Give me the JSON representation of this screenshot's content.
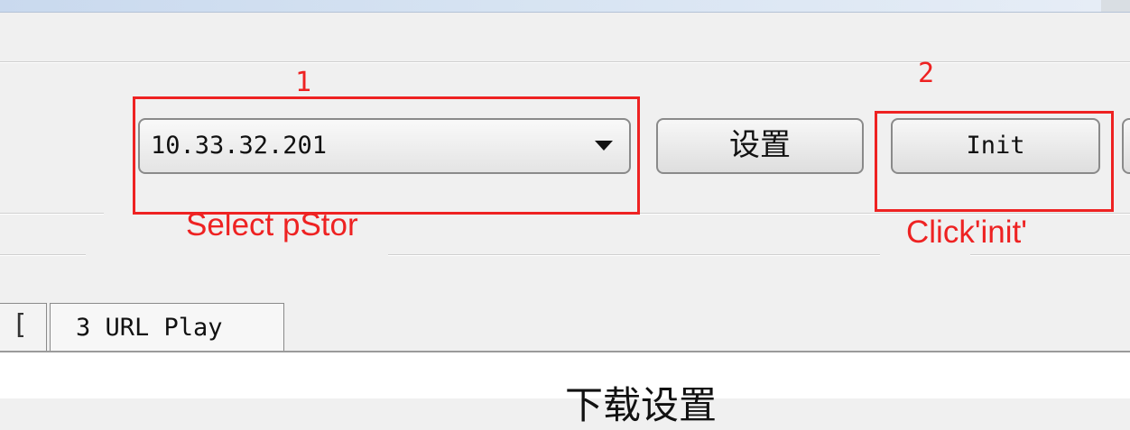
{
  "pstor_combo": {
    "value": "10.33.32.201"
  },
  "buttons": {
    "settings_label": "设置",
    "init_label": "Init"
  },
  "annotations": {
    "step1_number": "1",
    "step2_number": "2",
    "step1_text": "Select pStor",
    "step2_text": "Click'init'"
  },
  "tabs": {
    "items": [
      {
        "label": "["
      },
      {
        "label": "3 URL Play"
      }
    ]
  },
  "section": {
    "title": "下载设置"
  },
  "colors": {
    "annotation": "#ee2222",
    "window_bg": "#f0f0f0",
    "titlebar": "#c9d9ee"
  },
  "icons": {
    "combo_arrow": "dropdown-arrow-icon"
  }
}
